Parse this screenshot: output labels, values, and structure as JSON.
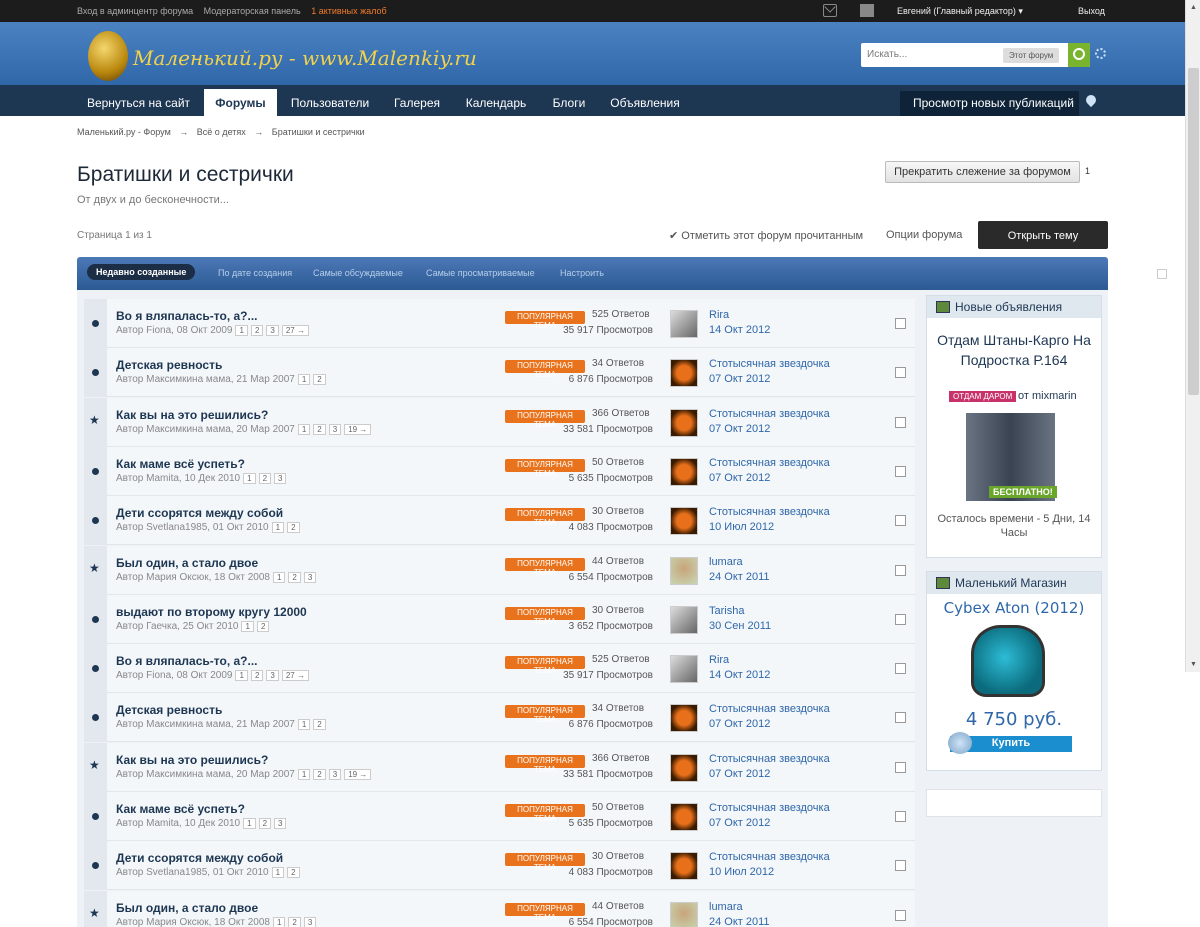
{
  "topbar": {
    "links": [
      "Вход в админцентр форума",
      "Модераторская панель"
    ],
    "reports": "1 активных жалоб",
    "user": "Евгений (Главный редактор) ▾",
    "logout": "Выход"
  },
  "header": {
    "logo": "Маленький.ру - www.Malenkiy.ru",
    "search_placeholder": "Искать...",
    "search_scope": "Этот форум"
  },
  "nav": {
    "tabs": [
      "Вернуться на сайт",
      "Форумы",
      "Пользователи",
      "Галерея",
      "Календарь",
      "Блоги",
      "Объявления"
    ],
    "active": "Форумы",
    "new_posts": "Просмотр новых публикаций"
  },
  "breadcrumb": [
    "Маленький.ру - Форум",
    "→",
    "Всё о детях",
    "→",
    "Братишки и сестрички"
  ],
  "forum": {
    "title": "Братишки и сестрички",
    "description": "От двух и до бесконечности...",
    "follow_button": "Прекратить слежение за форумом",
    "followers": "1",
    "page_info": "Страница 1 из 1",
    "mark_read": "✔ Отметить этот форум прочитанным",
    "options": "Опции форума",
    "new_topic": "Открыть тему"
  },
  "filters": [
    "Недавно созданные",
    "По дате создания",
    "Самые обсуждаемые",
    "Самые просматриваемые",
    "Настроить"
  ],
  "badge_label": "ПОПУЛЯРНАЯ ТЕМА",
  "topics": [
    {
      "title": "Во я вляпалась-то, а?...",
      "author": "Автор Fiona, 08 Окт 2009",
      "pages": [
        "1",
        "2",
        "3",
        "27 →"
      ],
      "replies": "525 Ответов",
      "views": "35 917 Просмотров",
      "last_user": "Rira",
      "last_date": "14 Окт 2012",
      "icon": "dot",
      "avatar": "photo"
    },
    {
      "title": "Детская ревность",
      "author": "Автор Максимкина мама, 21 Мар 2007",
      "pages": [
        "1",
        "2"
      ],
      "replies": "34 Ответов",
      "views": "6 876 Просмотров",
      "last_user": "Стотысячная звездочка",
      "last_date": "07 Окт 2012",
      "icon": "dot",
      "avatar": "sun"
    },
    {
      "title": "Как вы на это решились?",
      "author": "Автор Максимкина мама, 20 Мар 2007",
      "pages": [
        "1",
        "2",
        "3",
        "19 →"
      ],
      "replies": "366 Ответов",
      "views": "33 581 Просмотров",
      "last_user": "Стотысячная звездочка",
      "last_date": "07 Окт 2012",
      "icon": "star",
      "avatar": "sun"
    },
    {
      "title": "Как маме всё успеть?",
      "author": "Автор Mamita, 10 Дек 2010",
      "pages": [
        "1",
        "2",
        "3"
      ],
      "replies": "50 Ответов",
      "views": "5 635 Просмотров",
      "last_user": "Стотысячная звездочка",
      "last_date": "07 Окт 2012",
      "icon": "dot",
      "avatar": "sun"
    },
    {
      "title": "Дети ссорятся между собой",
      "author": "Автор Svetlana1985, 01 Окт 2010",
      "pages": [
        "1",
        "2"
      ],
      "replies": "30 Ответов",
      "views": "4 083 Просмотров",
      "last_user": "Стотысячная звездочка",
      "last_date": "10 Июл 2012",
      "icon": "dot",
      "avatar": "sun"
    },
    {
      "title": "Был один, а стало двое",
      "author": "Автор Мария Оксюк, 18 Окт 2008",
      "pages": [
        "1",
        "2",
        "3"
      ],
      "replies": "44 Ответов",
      "views": "6 554 Просмотров",
      "last_user": "lumara",
      "last_date": "24 Окт 2011",
      "icon": "star",
      "avatar": "girl"
    },
    {
      "title": "выдают по второму кругу 12000",
      "author": "Автор Гаечка, 25 Окт 2010",
      "pages": [
        "1",
        "2"
      ],
      "replies": "30 Ответов",
      "views": "3 652 Просмотров",
      "last_user": "Tarisha",
      "last_date": "30 Сен 2011",
      "icon": "dot",
      "avatar": "photo"
    },
    {
      "title": "Во я вляпалась-то, а?...",
      "author": "Автор Fiona, 08 Окт 2009",
      "pages": [
        "1",
        "2",
        "3",
        "27 →"
      ],
      "replies": "525 Ответов",
      "views": "35 917 Просмотров",
      "last_user": "Rira",
      "last_date": "14 Окт 2012",
      "icon": "dot",
      "avatar": "photo"
    },
    {
      "title": "Детская ревность",
      "author": "Автор Максимкина мама, 21 Мар 2007",
      "pages": [
        "1",
        "2"
      ],
      "replies": "34 Ответов",
      "views": "6 876 Просмотров",
      "last_user": "Стотысячная звездочка",
      "last_date": "07 Окт 2012",
      "icon": "dot",
      "avatar": "sun"
    },
    {
      "title": "Как вы на это решились?",
      "author": "Автор Максимкина мама, 20 Мар 2007",
      "pages": [
        "1",
        "2",
        "3",
        "19 →"
      ],
      "replies": "366 Ответов",
      "views": "33 581 Просмотров",
      "last_user": "Стотысячная звездочка",
      "last_date": "07 Окт 2012",
      "icon": "star",
      "avatar": "sun"
    },
    {
      "title": "Как маме всё успеть?",
      "author": "Автор Mamita, 10 Дек 2010",
      "pages": [
        "1",
        "2",
        "3"
      ],
      "replies": "50 Ответов",
      "views": "5 635 Просмотров",
      "last_user": "Стотысячная звездочка",
      "last_date": "07 Окт 2012",
      "icon": "dot",
      "avatar": "sun"
    },
    {
      "title": "Дети ссорятся между собой",
      "author": "Автор Svetlana1985, 01 Окт 2010",
      "pages": [
        "1",
        "2"
      ],
      "replies": "30 Ответов",
      "views": "4 083 Просмотров",
      "last_user": "Стотысячная звездочка",
      "last_date": "10 Июл 2012",
      "icon": "dot",
      "avatar": "sun"
    },
    {
      "title": "Был один, а стало двое",
      "author": "Автор Мария Оксюк, 18 Окт 2008",
      "pages": [
        "1",
        "2",
        "3"
      ],
      "replies": "44 Ответов",
      "views": "6 554 Просмотров",
      "last_user": "lumara",
      "last_date": "24 Окт 2011",
      "icon": "star",
      "avatar": "girl"
    }
  ],
  "sidebar": {
    "ads_title": "Новые объявления",
    "ad_title": "Отдам Штаны-Карго На Подростка Р.164",
    "ad_tag": "ОТДАМ ДАРОМ",
    "ad_by": "от mixmarin",
    "ad_free": "БЕСПЛАТНО!",
    "ad_time": "Осталось времени - 5 Дни, 14 Часы",
    "shop_title": "Маленький Магазин",
    "product": "Cybex Aton (2012)",
    "price": "4 750 руб.",
    "buy": "Купить"
  }
}
